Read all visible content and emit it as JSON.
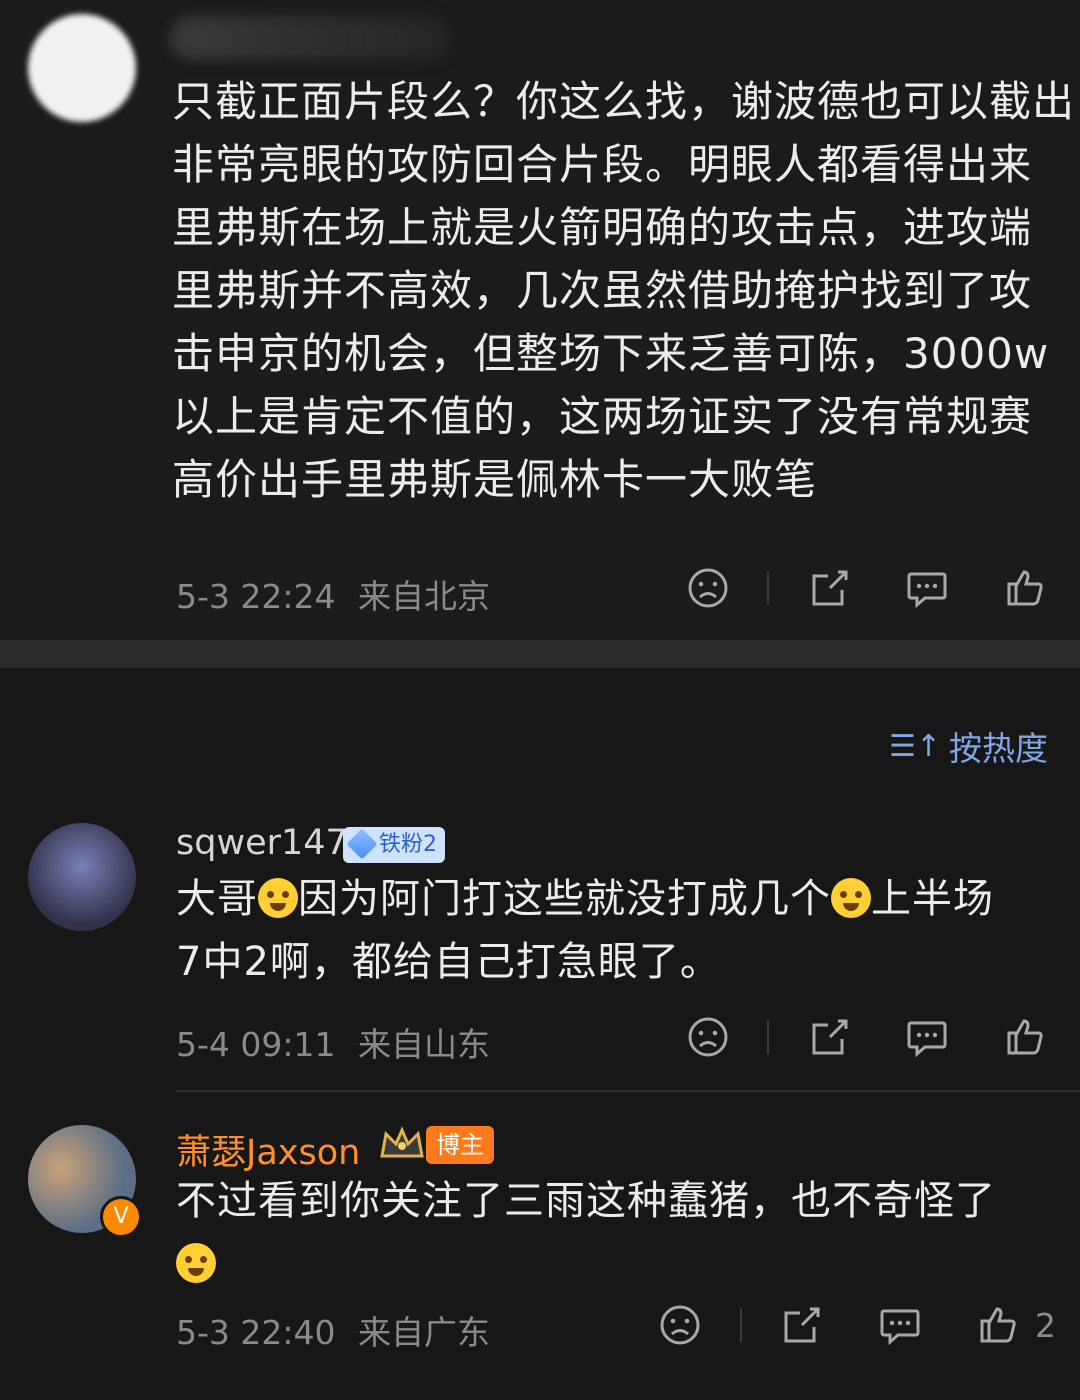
{
  "top_comment": {
    "text_lines": [
      "只截正面片段么？你这么找，谢波德也可以截出",
      "非常亮眼的攻防回合片段。明眼人都看得出来",
      "里弗斯在场上就是火箭明确的攻击点，进攻端",
      "里弗斯并不高效，几次虽然借助掩护找到了攻",
      "击申京的机会，但整场下来乏善可陈，3000w",
      "以上是肯定不值的，这两场证实了没有常规赛",
      "高价出手里弗斯是佩林卡一大败笔"
    ],
    "time": "5-3 22:24",
    "location": "来自北京"
  },
  "sort": {
    "label": "按热度",
    "icon": "sort-icon"
  },
  "reply1": {
    "username": "sqwer147",
    "badge": "铁粉2",
    "line1_parts": [
      "大哥",
      "因为阿门打这些就没打成几个",
      "上半场"
    ],
    "line2": "7中2啊，都给自己打急眼了。",
    "time": "5-4 09:11",
    "location": "来自山东"
  },
  "reply2": {
    "username": "萧瑟Jaxson",
    "badge": "博主",
    "line1": "不过看到你关注了三雨这种蠢猪，也不奇怪了",
    "time": "5-3 22:40",
    "location": "来自广东",
    "like_count": "2"
  },
  "colors": {
    "accent_blue": "#7fa7e6",
    "accent_orange": "#ff7a1a"
  }
}
